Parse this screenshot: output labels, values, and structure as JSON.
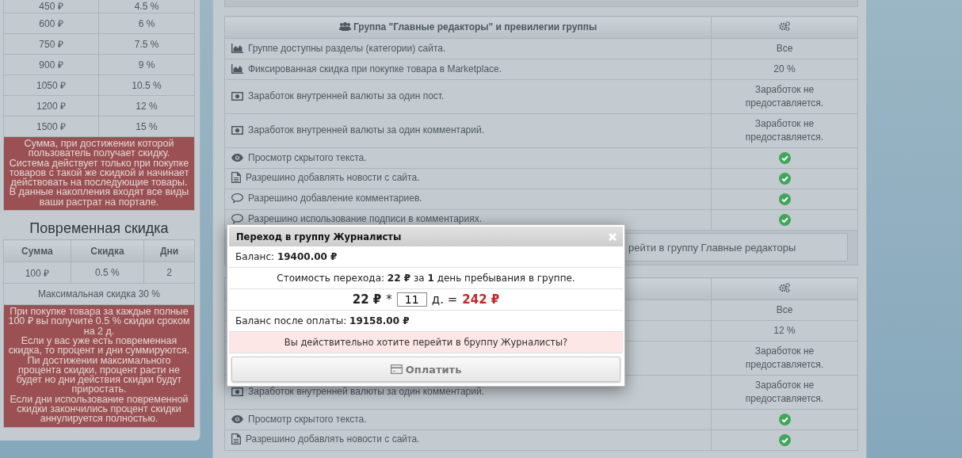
{
  "discount_table": {
    "rows": [
      {
        "sum": "450 ₽",
        "discount": "4.5 %"
      },
      {
        "sum": "600 ₽",
        "discount": "6 %"
      },
      {
        "sum": "750 ₽",
        "discount": "7.5 %"
      },
      {
        "sum": "900 ₽",
        "discount": "9 %"
      },
      {
        "sum": "1050 ₽",
        "discount": "10.5 %"
      },
      {
        "sum": "1200 ₽",
        "discount": "12 %"
      },
      {
        "sum": "1500 ₽",
        "discount": "15 %"
      }
    ],
    "note": "Сумма, при достижении которой пользователь получает скидку.\nСистема действует только при покупке товаров с такой же скидкой и начинает действовать на последующие товары.\nВ данные накопления входят все виды ваши растрат на портале."
  },
  "temporary_discount": {
    "title": "Повременная скидка",
    "columns": [
      "Сумма",
      "Скидка",
      "Дни"
    ],
    "rows": [
      [
        "100 ₽",
        "0.5 %",
        "2"
      ]
    ],
    "footer": "Максимальная скидка 30 %",
    "note": "При покупке товара за каждые полные 100 ₽ вы получите 0.5 % скидки сроком на 2 д.\nЕсли у вас уже есть повременная скидка, то процент и дни суммируются.\nПи достижении максимального процента скидки, процент расти не будет но дни действия скидки будут приростать.\nЕсли дни использование повременной скидки закончились процент скидки аннулируется полностью."
  },
  "groups": [
    {
      "header": "Группа \"Главные редакторы\" и превилегии группы",
      "rows": [
        {
          "kind": "access",
          "label": "Группе доступны разделы (категории) сайта.",
          "value": "Все"
        },
        {
          "kind": "discount",
          "label": "Фиксированная скидка при покупке товара в Marketplace.",
          "value": "20 %"
        },
        {
          "kind": "earning",
          "label": "Заработок внутренней валюты за один пост.",
          "value": "Заработок не предоставляется."
        },
        {
          "kind": "earning",
          "label": "Заработок внутренней валюты за один комментарий.",
          "value": "Заработок не предоставляется."
        },
        {
          "kind": "hidden_text",
          "label": "Просмотр скрытого текста.",
          "allowed": true
        },
        {
          "kind": "news",
          "label": "Разрешино добавлять новости с сайта.",
          "allowed": true
        },
        {
          "kind": "comments",
          "label": "Разрешино добавление комментариев.",
          "allowed": true
        },
        {
          "kind": "comments",
          "label": "Разрешино использование подписи в комментариях.",
          "allowed": true
        }
      ],
      "button": "рейти в группу Главные редакторы"
    },
    {
      "rows": [
        {
          "value": "Все"
        },
        {
          "value": "12 %"
        },
        {
          "value": "Заработок не предоставляется."
        },
        {
          "kind": "earning",
          "label": "Заработок внутренней валюты за один комментарий.",
          "value": "Заработок не предоставляется."
        },
        {
          "kind": "hidden_text",
          "label": "Просмотр скрытого текста.",
          "allowed": true
        },
        {
          "kind": "news",
          "label": "Разрешино добавлять новости с сайта.",
          "allowed": true
        }
      ]
    }
  ],
  "modal": {
    "title": "Переход в группу Журналисты",
    "balance": "Баланс: **19400.00 ₽**",
    "cost": "Стоимость перехода: **22 ₽** за **1** день пребывания в группе.",
    "price": "22 ₽",
    "operator": "*",
    "days": "11",
    "unit": "д. =",
    "total": "242 ₽",
    "balance_after": "Баланс после оплаты: **19158.00 ₽**",
    "confirm": "Вы действительно хотите перейти в бруппу Журналисты?",
    "pay_button": "Оплатить"
  }
}
